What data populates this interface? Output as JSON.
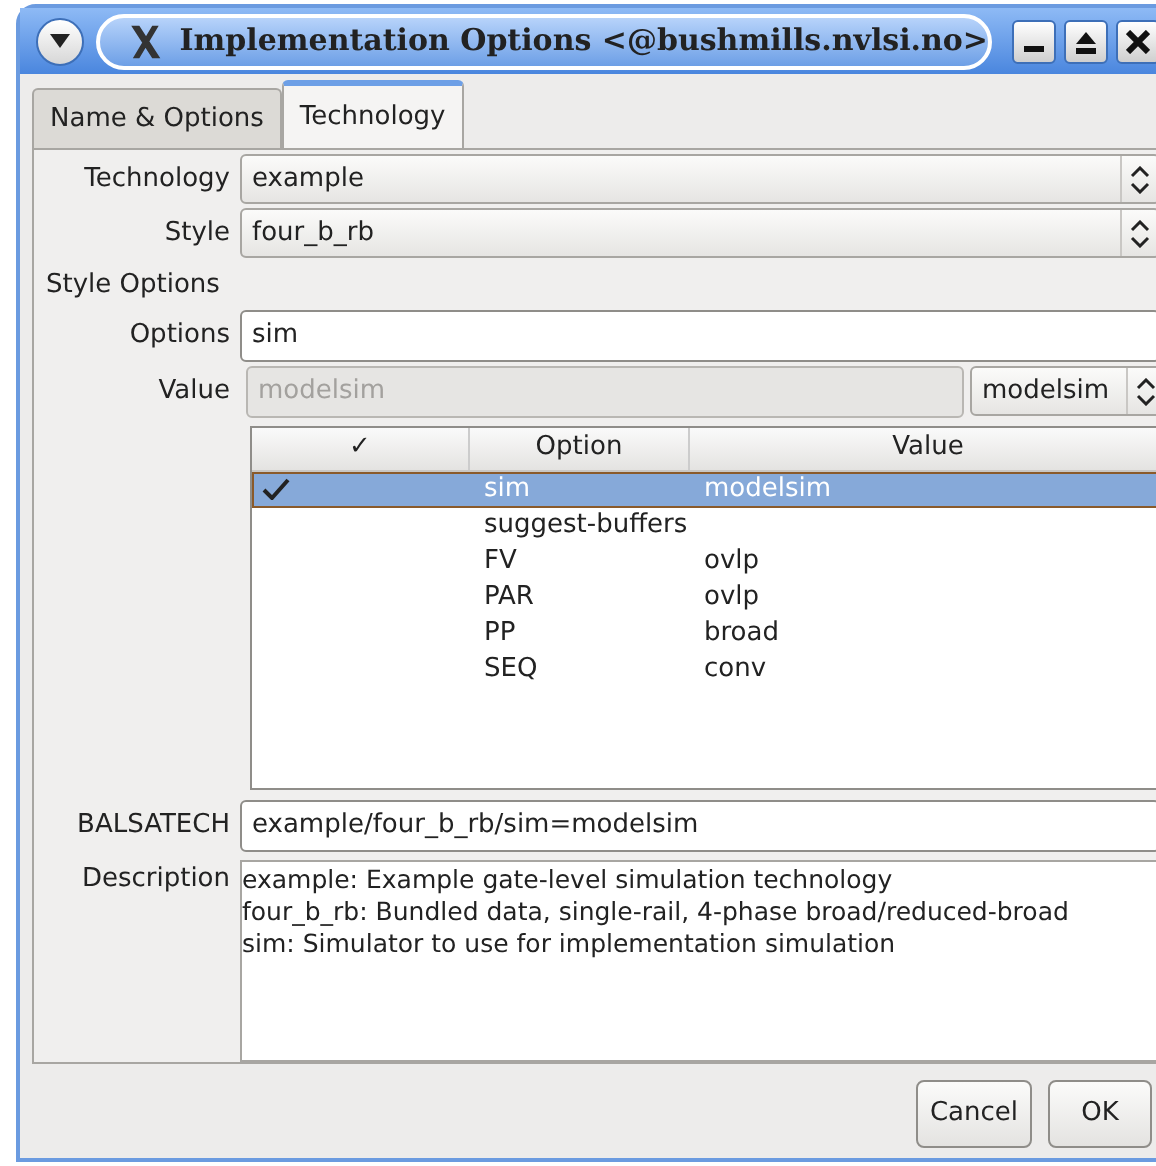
{
  "window": {
    "title": "Implementation Options <@bushmills.nvlsi.no>"
  },
  "tabs": [
    {
      "label": "Name & Options",
      "selected": false
    },
    {
      "label": "Technology",
      "selected": true
    }
  ],
  "technology": {
    "label": "Technology",
    "value": "example"
  },
  "style": {
    "label": "Style",
    "value": "four_b_rb"
  },
  "style_options_heading": "Style Options",
  "options": {
    "label": "Options",
    "value": "sim"
  },
  "value": {
    "label": "Value",
    "field_value": "modelsim",
    "disabled": true,
    "choice": "modelsim"
  },
  "table": {
    "columns": [
      "✓",
      "Option",
      "Value"
    ],
    "rows": [
      {
        "checked": true,
        "selected": true,
        "option": "sim",
        "value": "modelsim"
      },
      {
        "checked": false,
        "selected": false,
        "option": "suggest-buffers",
        "value": ""
      },
      {
        "checked": false,
        "selected": false,
        "option": "FV",
        "value": "ovlp"
      },
      {
        "checked": false,
        "selected": false,
        "option": "PAR",
        "value": "ovlp"
      },
      {
        "checked": false,
        "selected": false,
        "option": "PP",
        "value": "broad"
      },
      {
        "checked": false,
        "selected": false,
        "option": "SEQ",
        "value": "conv"
      }
    ]
  },
  "balsatech": {
    "label": "BALSATECH",
    "value": "example/four_b_rb/sim=modelsim"
  },
  "description": {
    "label": "Description",
    "lines": [
      "example: Example gate-level simulation technology",
      "four_b_rb: Bundled data, single-rail, 4-phase broad/reduced-broad",
      "sim: Simulator to use for implementation simulation"
    ]
  },
  "buttons": [
    "Cancel",
    "OK"
  ]
}
